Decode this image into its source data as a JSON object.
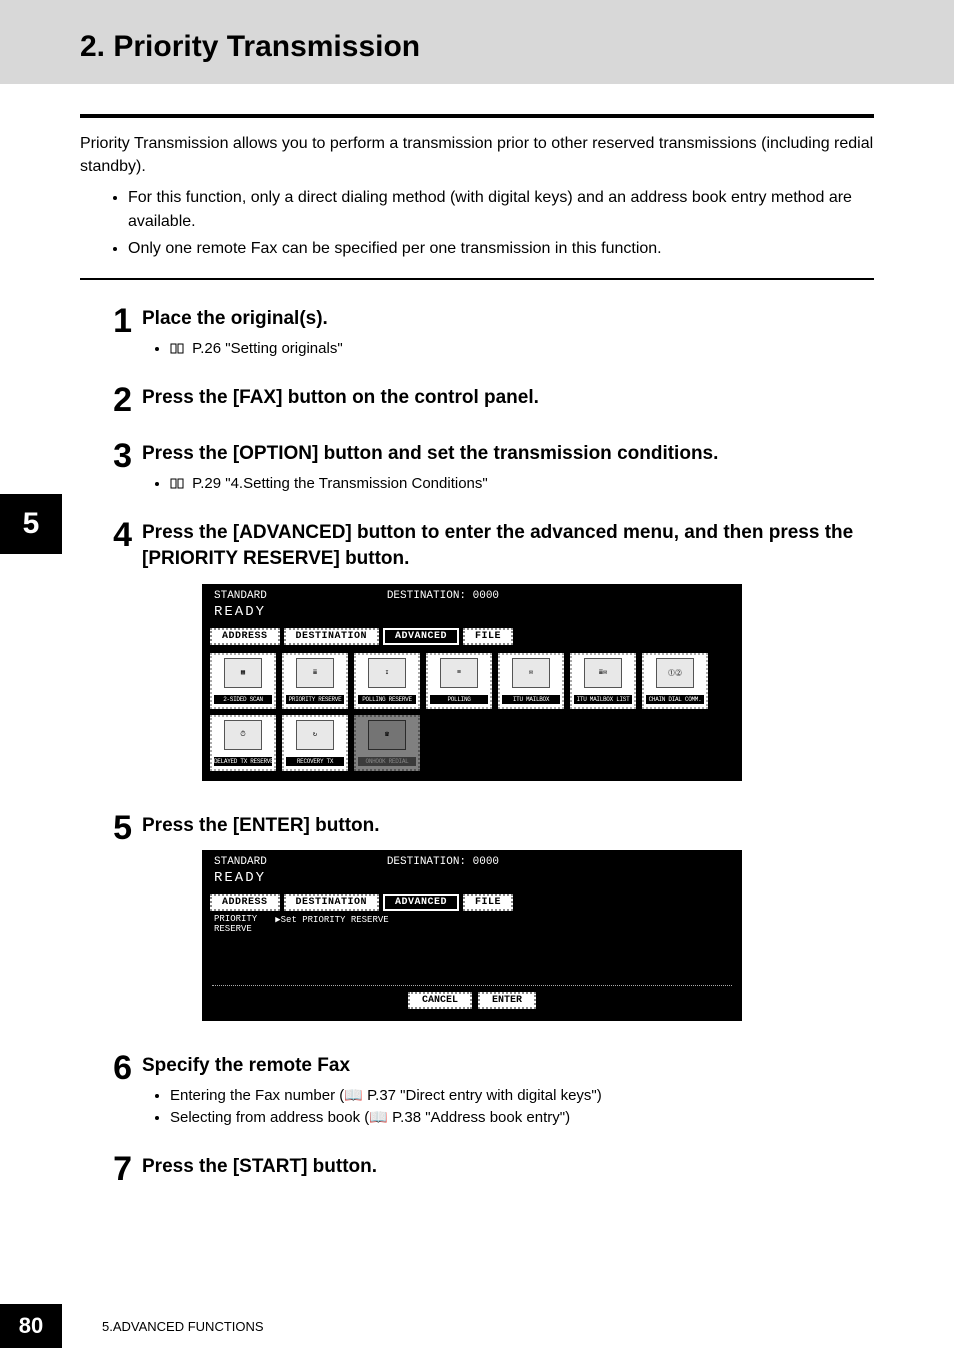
{
  "header": {
    "title": "2. Priority Transmission"
  },
  "side_tab": "5",
  "intro": {
    "text": "Priority Transmission allows you to perform a transmission prior to other reserved transmissions (including redial standby).",
    "bullets": [
      "For this function, only a direct dialing method (with digital keys) and an address book entry method are available.",
      "Only one remote Fax can be specified per one transmission in this function."
    ]
  },
  "steps": [
    {
      "num": "1",
      "title": "Place the original(s).",
      "subs": [
        "P.26 \"Setting originals\""
      ]
    },
    {
      "num": "2",
      "title": "Press the [FAX] button on the control panel."
    },
    {
      "num": "3",
      "title": "Press the [OPTION] button and set the transmission conditions.",
      "subs": [
        "P.29 \"4.Setting the Transmission Conditions\""
      ]
    },
    {
      "num": "4",
      "title": "Press the [ADVANCED] button to enter the advanced menu, and then press the [PRIORITY RESERVE] button."
    },
    {
      "num": "5",
      "title": "Press the [ENTER] button."
    },
    {
      "num": "6",
      "title": "Specify the remote Fax",
      "subs_plain": [
        "Entering the Fax number (📖 P.37 \"Direct entry with digital keys\")",
        "Selecting from address book (📖 P.38 \"Address book entry\")"
      ]
    },
    {
      "num": "7",
      "title": "Press the [START] button."
    }
  ],
  "screen1": {
    "standard": "STANDARD",
    "destination": "DESTINATION: 0000",
    "ready": "READY",
    "tabs": [
      "ADDRESS",
      "DESTINATION",
      "ADVANCED",
      "FILE"
    ],
    "icons": [
      "2-SIDED SCAN",
      "PRIORITY RESERVE",
      "POLLING RESERVE",
      "POLLING",
      "ITU MAILBOX",
      "ITU MAILBOX LIST",
      "CHAIN DIAL COMM.",
      "DELAYED TX RESERVE",
      "RECOVERY TX",
      "ONHOOK REDIAL"
    ]
  },
  "screen2": {
    "standard": "STANDARD",
    "destination": "DESTINATION: 0000",
    "ready": "READY",
    "tabs": [
      "ADDRESS",
      "DESTINATION",
      "ADVANCED",
      "FILE"
    ],
    "left_label": "PRIORITY\nRESERVE",
    "line": "▶Set PRIORITY RESERVE",
    "buttons": [
      "CANCEL",
      "ENTER"
    ]
  },
  "footer": {
    "page": "80",
    "text": "5.ADVANCED FUNCTIONS"
  }
}
